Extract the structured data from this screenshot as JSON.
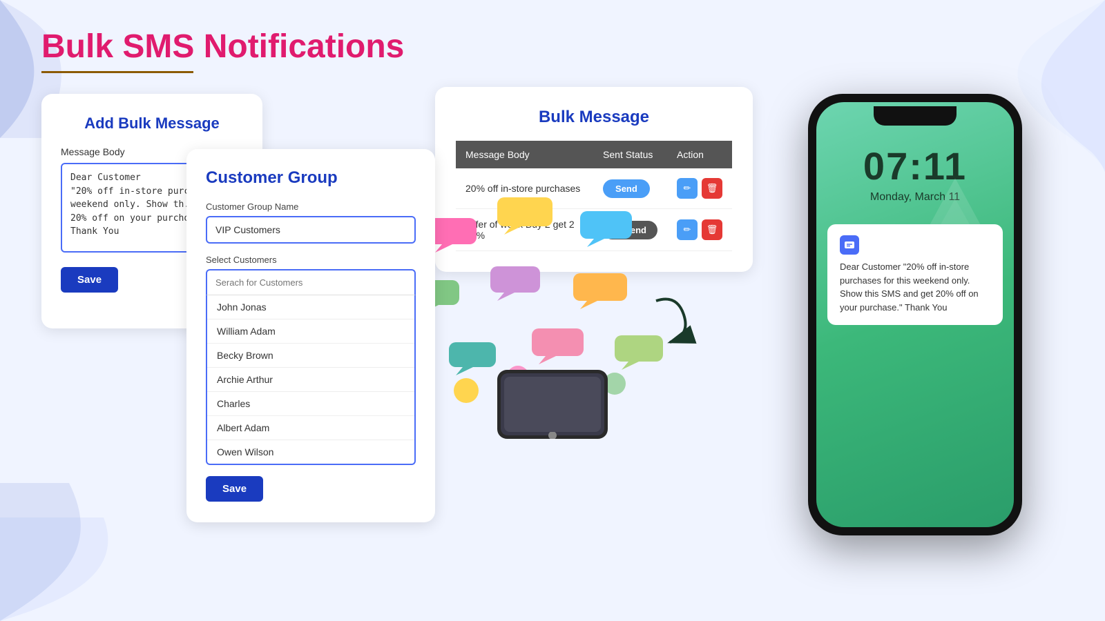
{
  "page": {
    "title": "Bulk SMS Notifications",
    "title_underline": true
  },
  "add_bulk_card": {
    "heading": "Add Bulk Message",
    "form_label": "Message Body",
    "message_value": "Dear Customer\n\"20% off in-store purch...\nweekend only. Show th...\n20% off on your purcho...\nThank You",
    "save_label": "Save"
  },
  "customer_group_card": {
    "heading": "Customer Group",
    "group_name_label": "Customer Group Name",
    "group_name_value": "VIP Customers",
    "select_customers_label": "Select Customers",
    "search_placeholder": "Serach for Customers",
    "customers": [
      "John Jonas",
      "William Adam",
      "Becky Brown",
      "Archie Arthur",
      "Charles",
      "Albert Adam",
      "Owen Wilson"
    ],
    "save_label": "Save"
  },
  "bulk_message_card": {
    "heading": "Bulk Message",
    "table": {
      "headers": [
        "Message Body",
        "Sent Status",
        "Action"
      ],
      "rows": [
        {
          "message": "20% off in-store purchases",
          "status": "Send",
          "status_type": "send"
        },
        {
          "message": "Offer of week Buy 2 get 2  50%",
          "status": "Resend",
          "status_type": "resend"
        }
      ]
    }
  },
  "phone_mockup": {
    "time": "07:11",
    "date": "Monday, March 11",
    "sms_text": "Dear Customer \"20% off in-store purchases for this weekend only. Show this SMS and get 20% off on your purchase.\" Thank You"
  },
  "colors": {
    "primary_blue": "#1a3bbf",
    "pink_title": "#e01b6e",
    "send_blue": "#4a9ef7",
    "delete_red": "#e53935",
    "table_header_bg": "#555555"
  }
}
